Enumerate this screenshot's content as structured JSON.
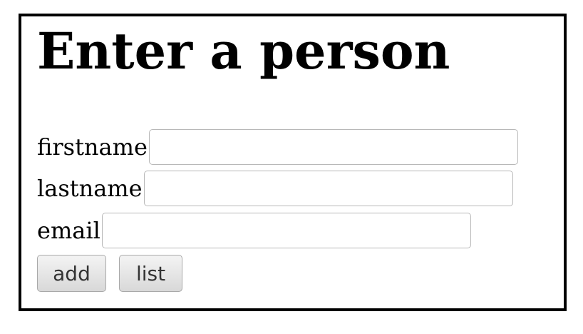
{
  "page": {
    "title": "Enter a person"
  },
  "form": {
    "firstname": {
      "label": "firstname",
      "value": "",
      "placeholder": ""
    },
    "lastname": {
      "label": "lastname",
      "value": "",
      "placeholder": ""
    },
    "email": {
      "label": "email",
      "value": "",
      "placeholder": ""
    }
  },
  "buttons": {
    "add_label": "add",
    "list_label": "list"
  }
}
